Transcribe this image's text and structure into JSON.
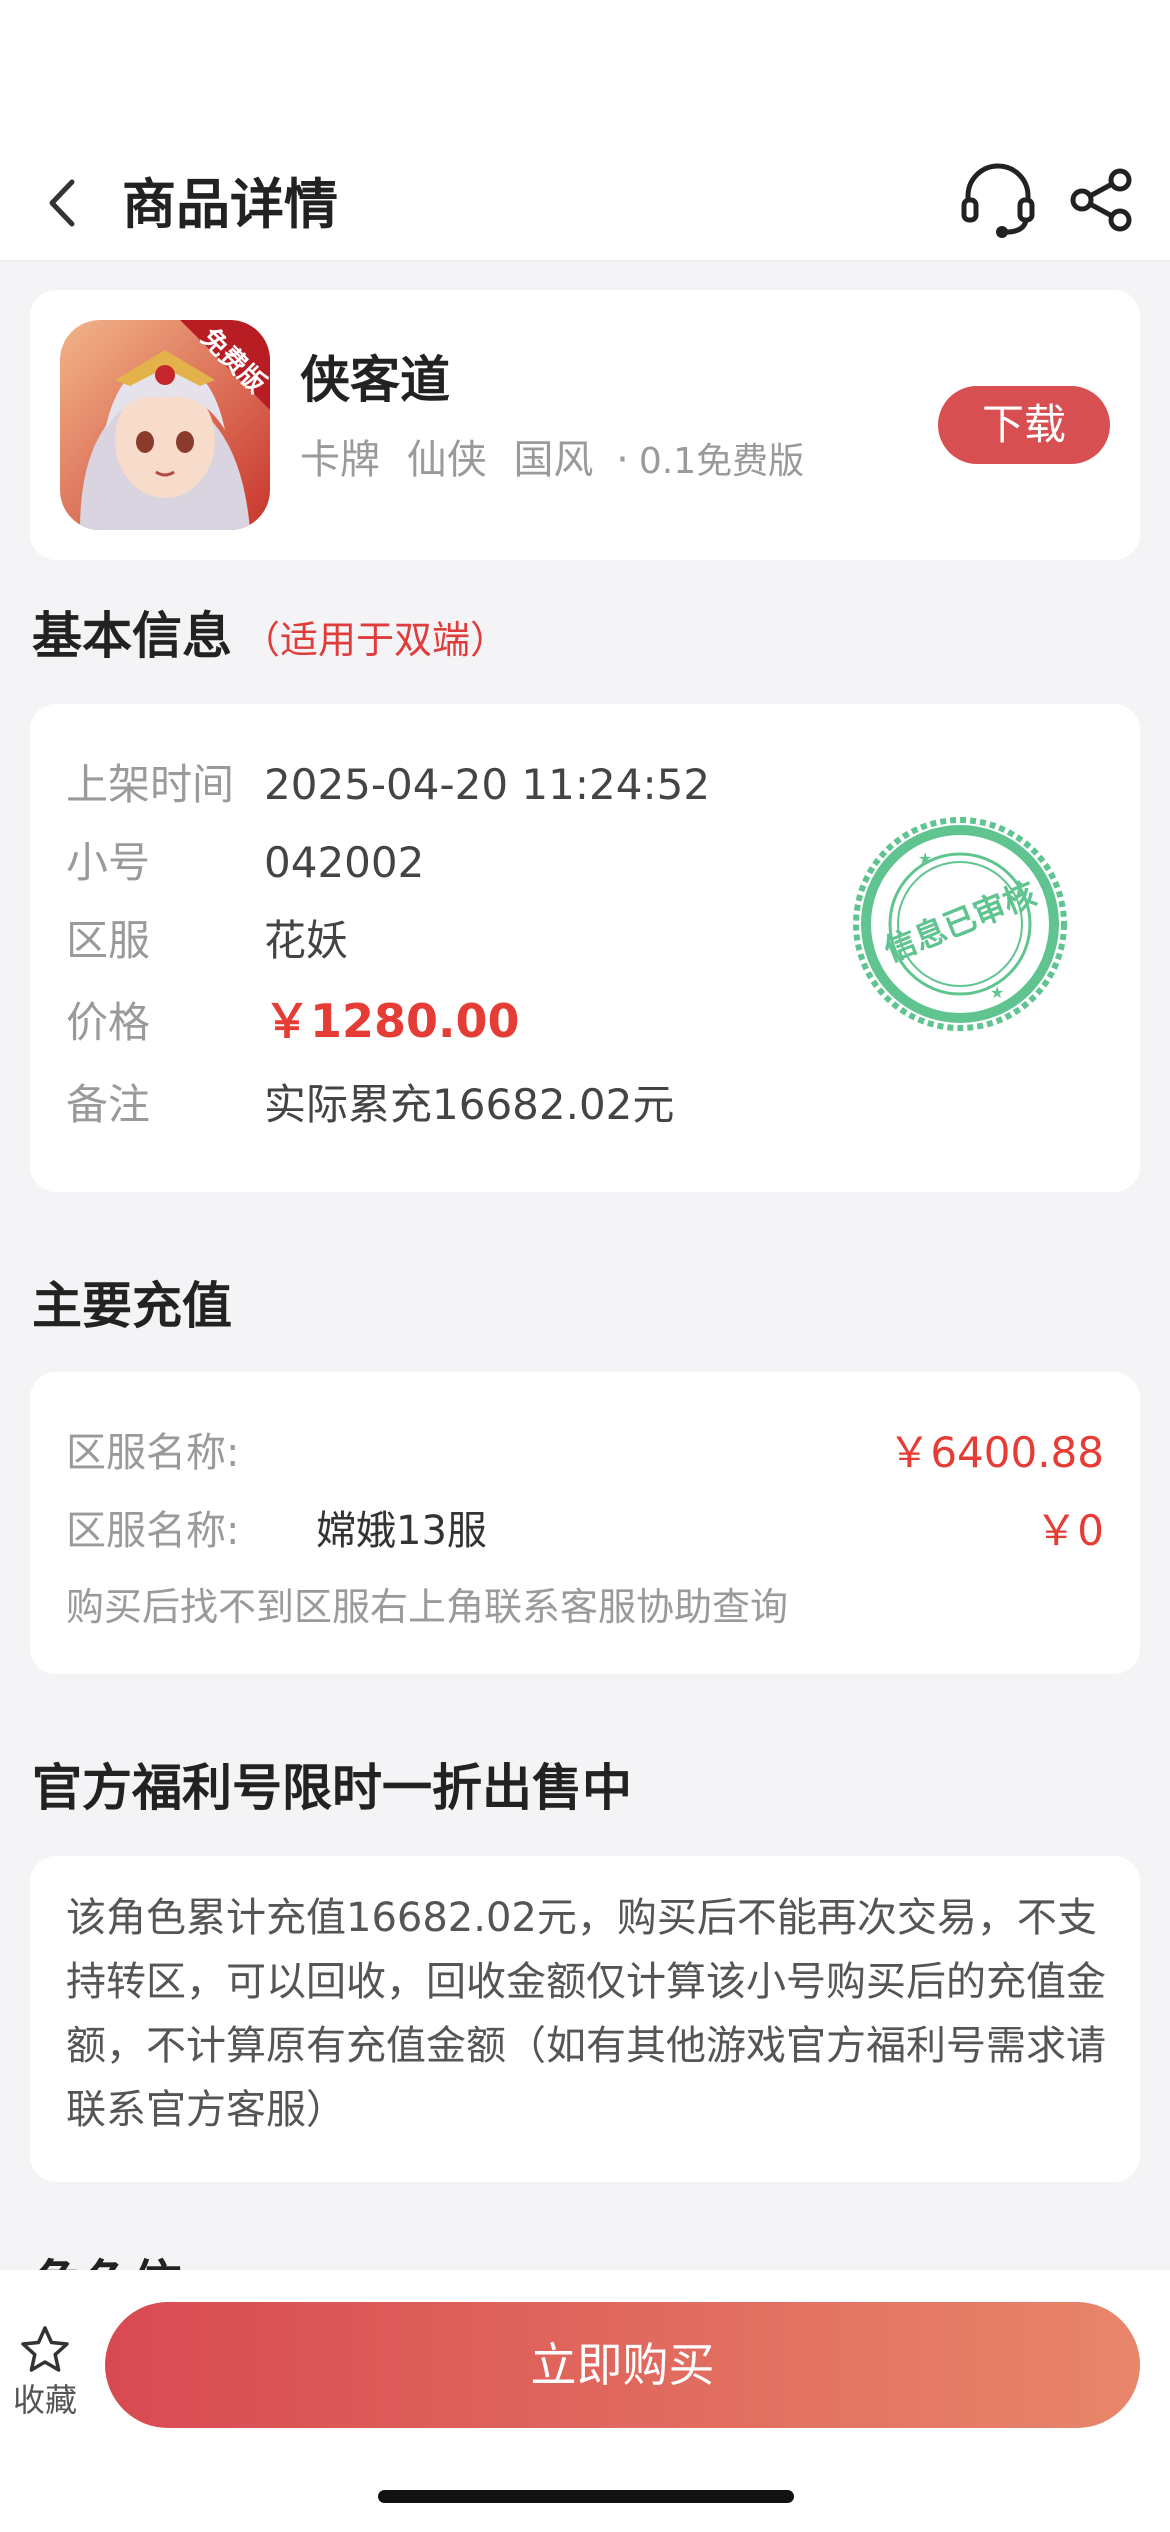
{
  "header": {
    "title": "商品详情"
  },
  "game": {
    "name": "侠客道",
    "tags": [
      "卡牌",
      "仙侠",
      "国风"
    ],
    "separator": "·",
    "version": "0.1免费版",
    "badge": "免费版",
    "download_label": "下载"
  },
  "basic": {
    "title": "基本信息",
    "subtitle": "（适用于双端）",
    "fields": [
      {
        "label": "上架时间",
        "value": "2025-04-20 11:24:52"
      },
      {
        "label": "小号",
        "value": "042002"
      },
      {
        "label": "区服",
        "value": "花妖"
      },
      {
        "label": "价格",
        "value": "￥1280.00"
      },
      {
        "label": "备注",
        "value": "实际累充16682.02元"
      }
    ],
    "stamp_text": "信息已审核"
  },
  "recharge": {
    "title": "主要充值",
    "rows": [
      {
        "label": "区服名称:",
        "server": "",
        "amount": "￥6400.88"
      },
      {
        "label": "区服名称:",
        "server": "嫦娥13服",
        "amount": "￥0"
      }
    ],
    "hint": "购买后找不到区服右上角联系客服协助查询"
  },
  "welfare": {
    "title": "官方福利号限时一折出售中",
    "description": "该角色累计充值16682.02元，购买后不能再次交易，不支持转区，可以回收，回收金额仅计算该小号购买后的充值金额，不计算原有充值金额（如有其他游戏官方福利号需求请联系官方客服）"
  },
  "next_section": {
    "title": "角色信息"
  },
  "bottom": {
    "favorite_label": "收藏",
    "buy_label": "立即购买"
  },
  "colors": {
    "accent": "#d84f52",
    "price": "#e53d35",
    "stamp": "#5fc48f",
    "page_bg": "#f4f4f6"
  }
}
